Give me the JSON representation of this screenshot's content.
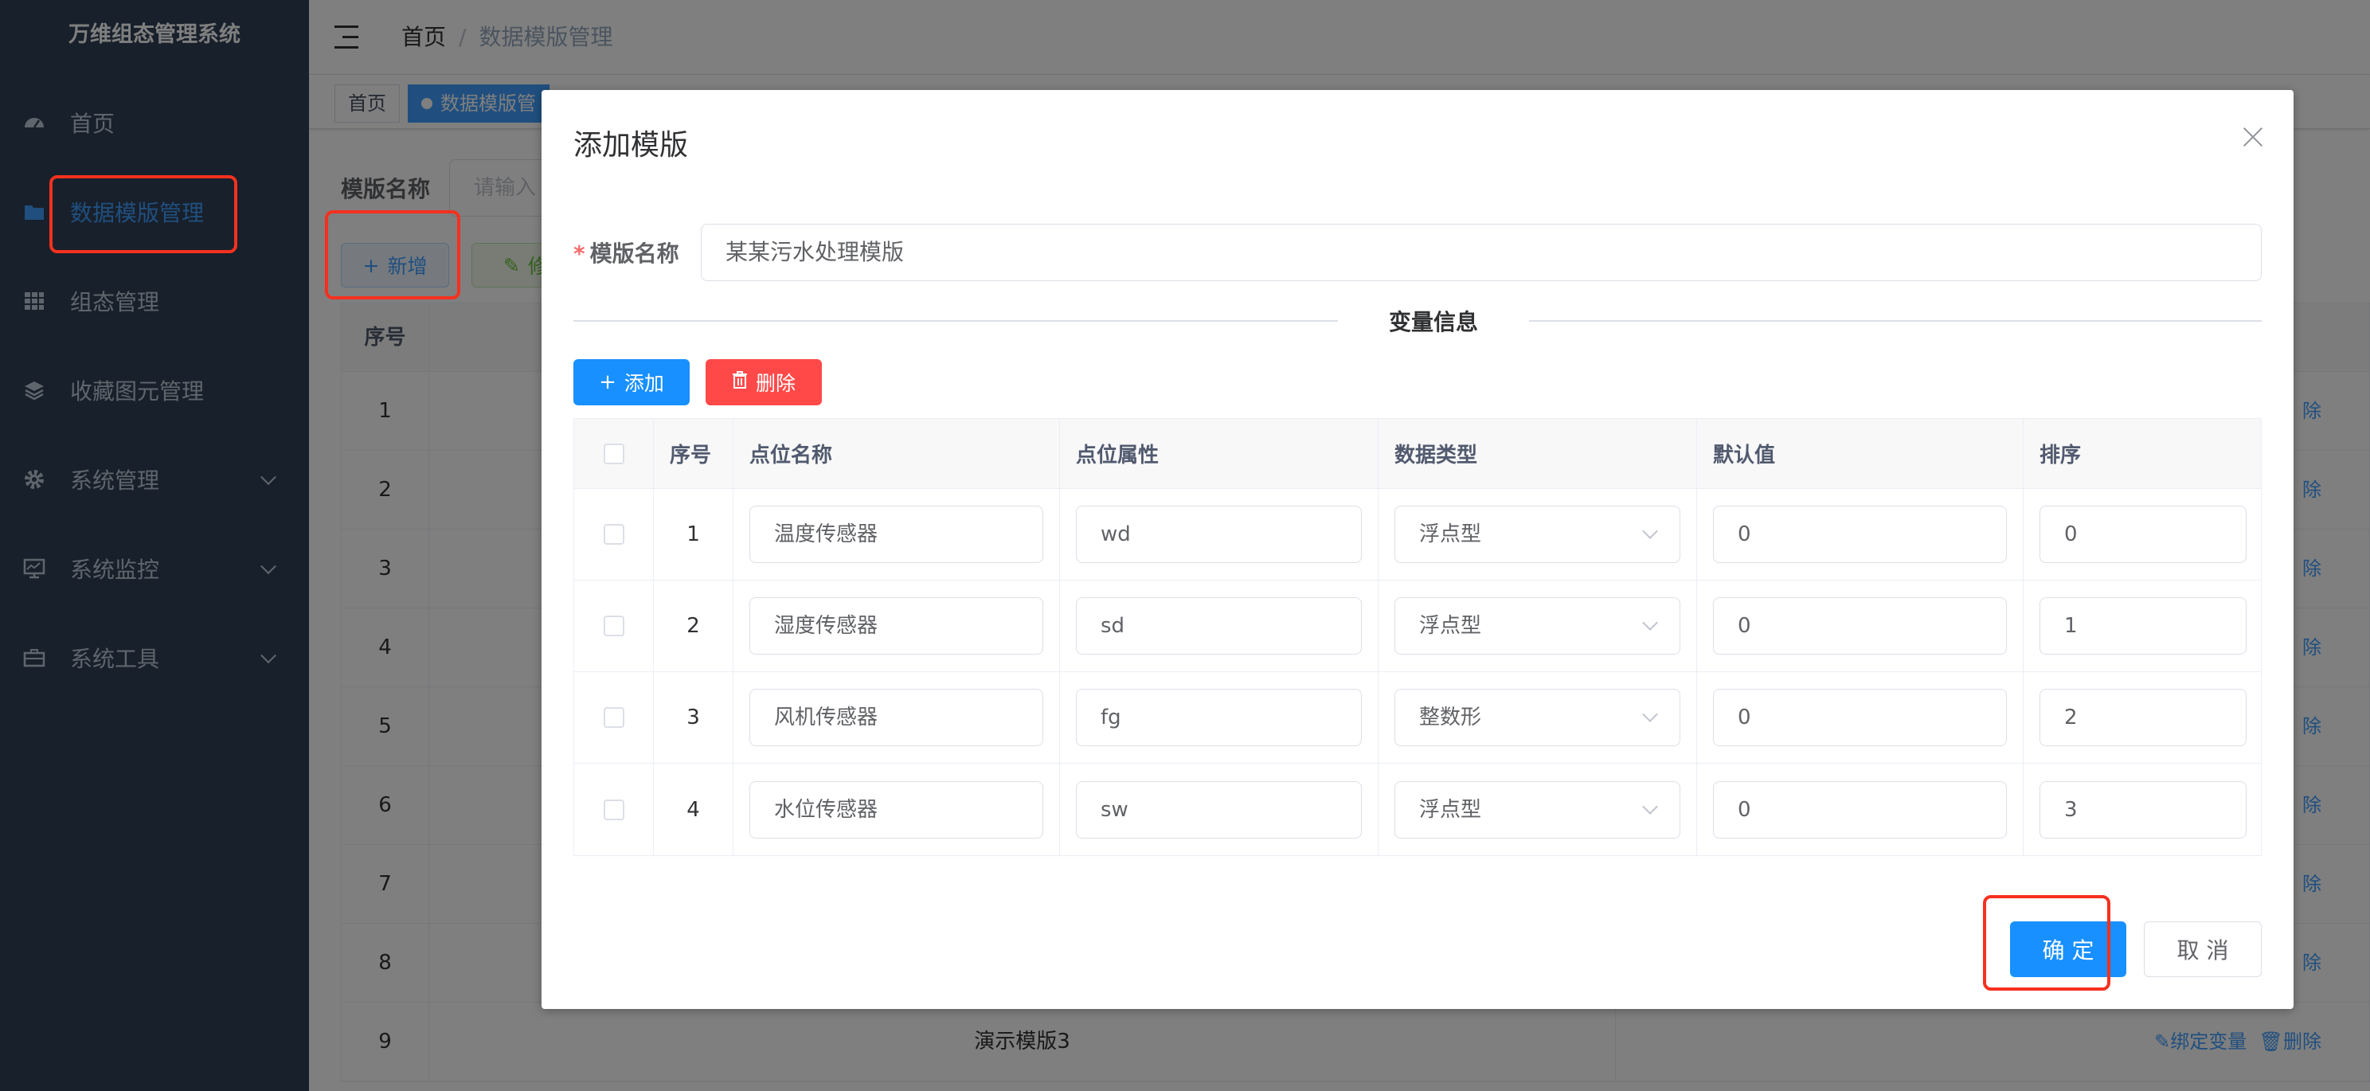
{
  "app": {
    "title": "万维组态管理系统"
  },
  "sidebar": {
    "items": [
      {
        "label": "首页",
        "icon": "dashboard-icon"
      },
      {
        "label": "数据模版管理",
        "icon": "folder-icon"
      },
      {
        "label": "组态管理",
        "icon": "grid-icon"
      },
      {
        "label": "收藏图元管理",
        "icon": "layers-icon"
      },
      {
        "label": "系统管理",
        "icon": "gear-icon"
      },
      {
        "label": "系统监控",
        "icon": "monitor-icon"
      },
      {
        "label": "系统工具",
        "icon": "toolbox-icon"
      }
    ]
  },
  "breadcrumb": {
    "home": "首页",
    "current": "数据模版管理"
  },
  "tags": [
    {
      "label": "首页"
    },
    {
      "label": "数据模版管"
    }
  ],
  "filter": {
    "label": "模版名称",
    "placeholder": "请输入"
  },
  "toolbar": {
    "add_label": "新增",
    "edit_label": "修"
  },
  "bg_table": {
    "header_index": "序号",
    "rows": [
      {
        "index": "1"
      },
      {
        "index": "2"
      },
      {
        "index": "3"
      },
      {
        "index": "4"
      },
      {
        "index": "5"
      },
      {
        "index": "6"
      },
      {
        "index": "7"
      },
      {
        "index": "8"
      },
      {
        "index": "9",
        "name": "演示模版3",
        "bind_label": "绑定变量",
        "delete_label": "删除"
      }
    ],
    "row_op_fragment": "除"
  },
  "dialog": {
    "title": "添加模版",
    "name_label": "模版名称",
    "name_value": "某某污水处理模版",
    "section_title": "变量信息",
    "add_label": "添加",
    "delete_label": "删除",
    "columns": [
      "序号",
      "点位名称",
      "点位属性",
      "数据类型",
      "默认值",
      "排序"
    ],
    "rows": [
      {
        "index": "1",
        "name": "温度传感器",
        "attr": "wd",
        "type": "浮点型",
        "default": "0",
        "order": "0"
      },
      {
        "index": "2",
        "name": "湿度传感器",
        "attr": "sd",
        "type": "浮点型",
        "default": "0",
        "order": "1"
      },
      {
        "index": "3",
        "name": "风机传感器",
        "attr": "fg",
        "type": "整数形",
        "default": "0",
        "order": "2"
      },
      {
        "index": "4",
        "name": "水位传感器",
        "attr": "sw",
        "type": "浮点型",
        "default": "0",
        "order": "3"
      }
    ],
    "confirm_label": "确 定",
    "cancel_label": "取 消"
  },
  "colors": {
    "sidebar_bg": "#304156",
    "primary": "#1890ff",
    "danger": "#ff4949",
    "highlight": "#f5311f"
  }
}
